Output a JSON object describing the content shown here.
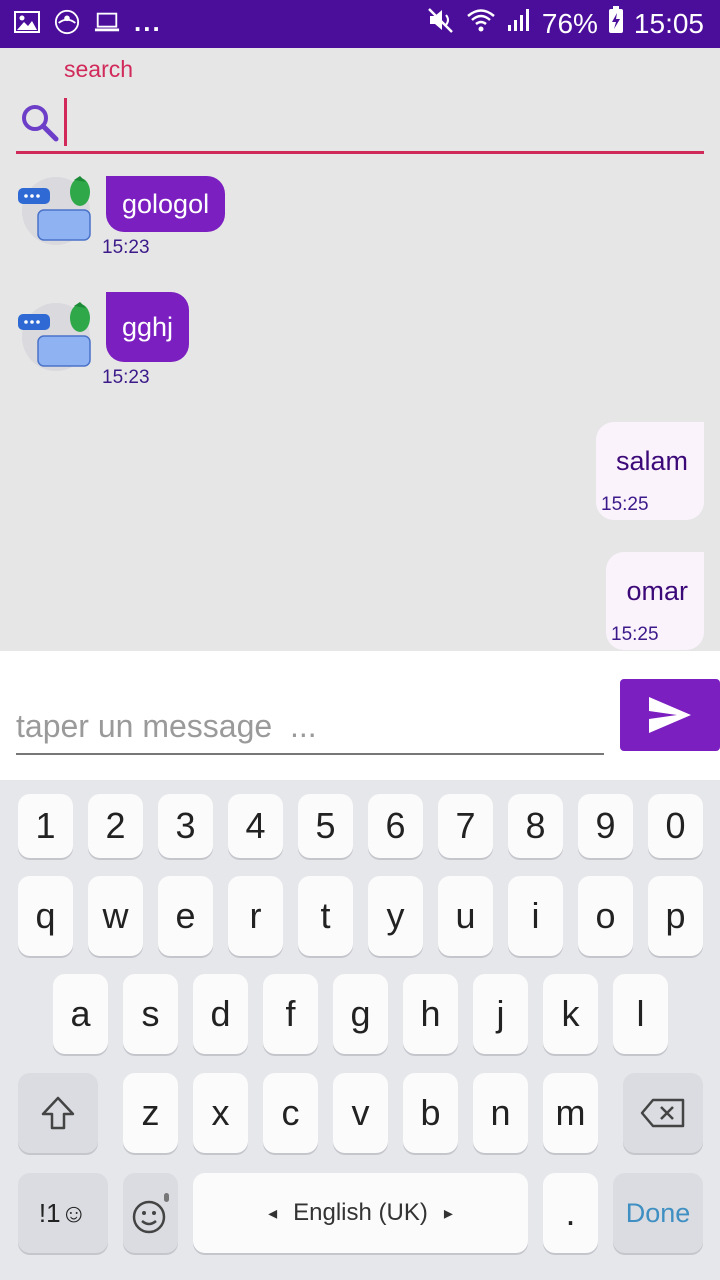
{
  "status_bar": {
    "time": "15:05",
    "battery": "76%",
    "more": "..."
  },
  "search": {
    "label": "search",
    "value": ""
  },
  "messages": [
    {
      "direction": "incoming",
      "text": "gologol",
      "time": "15:23"
    },
    {
      "direction": "incoming",
      "text": "gghj",
      "time": "15:23"
    },
    {
      "direction": "outgoing",
      "text": "salam",
      "time": "15:25"
    },
    {
      "direction": "outgoing",
      "text": "omar",
      "time": "15:25"
    }
  ],
  "composer": {
    "placeholder": "taper un message  ...",
    "value": ""
  },
  "keyboard": {
    "row1": [
      "1",
      "2",
      "3",
      "4",
      "5",
      "6",
      "7",
      "8",
      "9",
      "0"
    ],
    "row2": [
      "q",
      "w",
      "e",
      "r",
      "t",
      "y",
      "u",
      "i",
      "o",
      "p"
    ],
    "row3": [
      "a",
      "s",
      "d",
      "f",
      "g",
      "h",
      "j",
      "k",
      "l"
    ],
    "row4": [
      "z",
      "x",
      "c",
      "v",
      "b",
      "n",
      "m"
    ],
    "symbols_label": "!1☺",
    "space_label": "English (UK)",
    "period": ".",
    "done_label": "Done"
  },
  "colors": {
    "status_bar": "#4b0e9a",
    "accent": "#d1295a",
    "bubble_incoming": "#7b1fc0",
    "bubble_outgoing": "#fbf3fc",
    "send_button": "#7b1fc0"
  }
}
